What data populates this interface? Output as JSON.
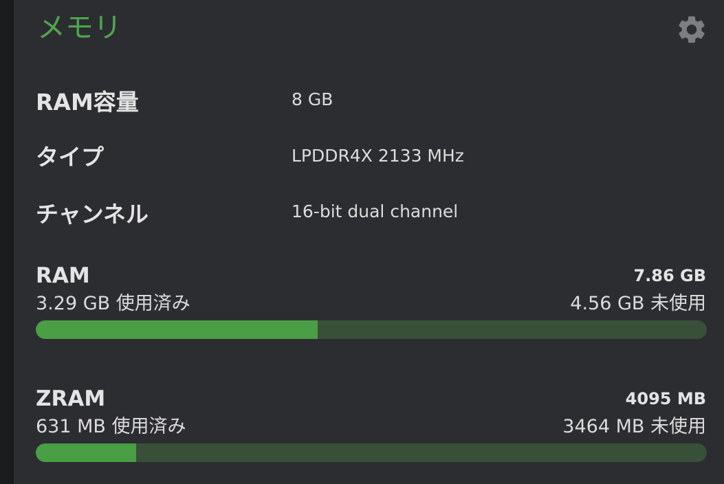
{
  "header": {
    "title": "メモリ",
    "settings_icon": "gear-icon"
  },
  "specs": [
    {
      "label": "RAM容量",
      "value": "8 GB"
    },
    {
      "label": "タイプ",
      "value": "LPDDR4X 2133 MHz"
    },
    {
      "label": "チャンネル",
      "value": "16-bit dual channel"
    }
  ],
  "ram": {
    "name": "RAM",
    "total": "7.86 GB",
    "used": "3.29 GB 使用済み",
    "free": "4.56 GB 未使用",
    "used_fraction": 0.42
  },
  "zram": {
    "name": "ZRAM",
    "total": "4095 MB",
    "used": "631 MB 使用済み",
    "free": "3464 MB 未使用",
    "used_fraction": 0.15
  },
  "colors": {
    "accent": "#4ea64c",
    "bar_fill": "#4a9e44",
    "bar_track": "#385038",
    "card_bg": "#2c2d31"
  }
}
